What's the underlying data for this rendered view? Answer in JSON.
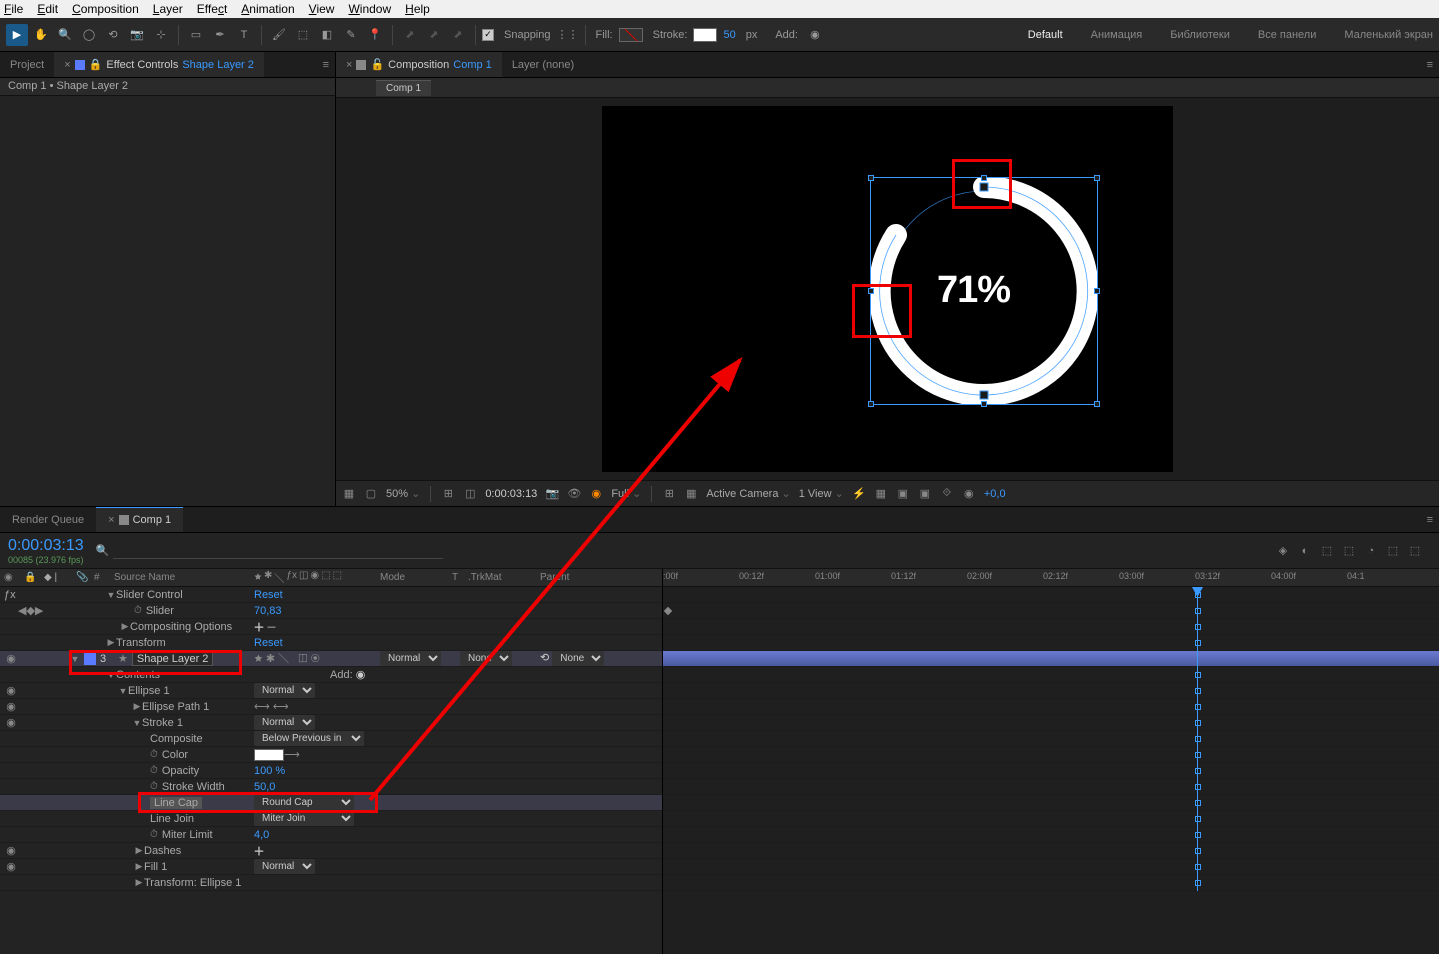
{
  "menu": {
    "file": "File",
    "edit": "Edit",
    "composition": "Composition",
    "layer": "Layer",
    "effect": "Effect",
    "animation": "Animation",
    "view": "View",
    "window": "Window",
    "help": "Help"
  },
  "toolbar": {
    "snapping": "Snapping",
    "fill": "Fill:",
    "stroke": "Stroke:",
    "stroke_val": "50",
    "stroke_unit": "px",
    "add": "Add:"
  },
  "workspace": {
    "default": "Default",
    "anim": "Анимация",
    "lib": "Библиотеки",
    "all": "Все панели",
    "small": "Маленький экран"
  },
  "left_panel": {
    "project_tab": "Project",
    "ec_tab": "Effect Controls",
    "ec_target": "Shape Layer 2",
    "subtitle": "Comp 1 • Shape Layer 2"
  },
  "comp_panel": {
    "comp_tab": "Composition",
    "comp_name": "Comp 1",
    "layer_tab": "Layer (none)",
    "sub_tab": "Comp 1",
    "pct_text": "71%"
  },
  "viewer_footer": {
    "zoom": "50%",
    "time": "0:00:03:13",
    "quality": "Full",
    "camera": "Active Camera",
    "views": "1 View",
    "exposure": "+0,0"
  },
  "timeline": {
    "rq_tab": "Render Queue",
    "comp_tab": "Comp 1",
    "timecode": "0:00:03:13",
    "frames": "00085 (23.976 fps)",
    "col_source": "Source Name",
    "col_mode": "Mode",
    "col_t": "T",
    "col_trkmat": ".TrkMat",
    "col_parent": "Parent",
    "add_label": "Add:",
    "rows": {
      "slider_control": "Slider Control",
      "reset": "Reset",
      "slider": "Slider",
      "slider_val": "70,83",
      "comp_options": "Compositing Options",
      "transform": "Transform",
      "layer_num": "3",
      "layer_name": "Shape Layer 2",
      "contents": "Contents",
      "ellipse1": "Ellipse 1",
      "normal": "Normal",
      "none": "None",
      "ellipse_path": "Ellipse Path 1",
      "stroke1": "Stroke 1",
      "composite": "Composite",
      "composite_val": "Below Previous in Sa",
      "color": "Color",
      "opacity": "Opacity",
      "opacity_val": "100 %",
      "stroke_width": "Stroke Width",
      "stroke_width_val": "50,0",
      "line_cap": "Line Cap",
      "line_cap_val": "Round Cap",
      "line_join": "Line Join",
      "line_join_val": "Miter Join",
      "miter_limit": "Miter Limit",
      "miter_limit_val": "4,0",
      "dashes": "Dashes",
      "fill1": "Fill 1",
      "transform_ellipse": "Transform: Ellipse 1"
    },
    "ruler_ticks": [
      ":00f",
      "00:12f",
      "01:00f",
      "01:12f",
      "02:00f",
      "02:12f",
      "03:00f",
      "03:12f",
      "04:00f",
      "04:1"
    ]
  }
}
